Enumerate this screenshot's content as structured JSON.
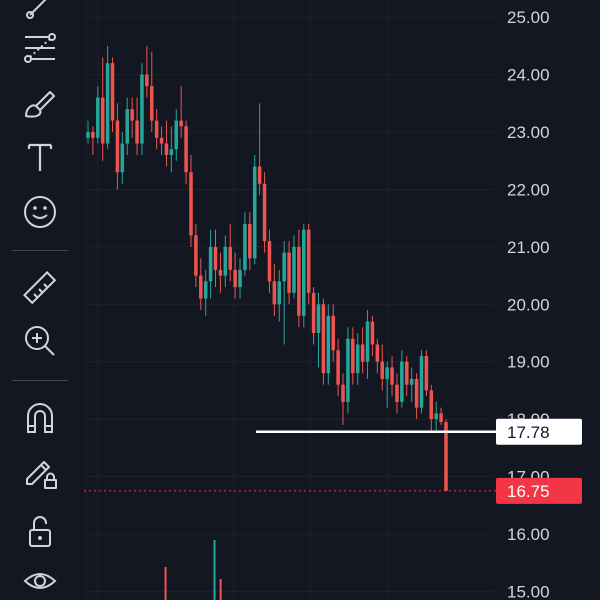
{
  "toolbar": {
    "icons": [
      "trend-line-icon",
      "fib-retracement-icon",
      "brush-icon",
      "text-icon",
      "emoji-icon",
      "ruler-icon",
      "zoom-in-icon",
      "magnet-icon",
      "lock-drawing-icon",
      "unlock-icon",
      "eye-icon"
    ]
  },
  "colors": {
    "background": "#131722",
    "grid": "#1e222d",
    "up": "#26a69a",
    "down": "#ef5350",
    "axis_text": "#d1d4dc",
    "horizontal_line": "#ffffff",
    "last_price_bg": "#f23645"
  },
  "chart_data": {
    "type": "candlestick",
    "ylim": [
      14.85,
      25.3
    ],
    "y_ticks": [
      "25.00",
      "24.00",
      "23.00",
      "22.00",
      "21.00",
      "20.00",
      "19.00",
      "18.00",
      "17.00",
      "16.00",
      "15.00"
    ],
    "horizontal_line": {
      "value": 17.78,
      "label": "17.78"
    },
    "last_price": {
      "value": 16.75,
      "label": "16.75"
    },
    "candles": [
      [
        22.9,
        23.2,
        22.8,
        23.0
      ],
      [
        23.0,
        23.1,
        22.6,
        22.9
      ],
      [
        22.9,
        23.8,
        22.8,
        23.6
      ],
      [
        23.6,
        24.3,
        22.5,
        22.8
      ],
      [
        22.8,
        24.5,
        22.7,
        24.2
      ],
      [
        24.2,
        24.3,
        23.0,
        23.2
      ],
      [
        23.2,
        23.5,
        22.0,
        22.3
      ],
      [
        22.3,
        23.0,
        22.1,
        22.8
      ],
      [
        22.8,
        23.6,
        22.6,
        23.4
      ],
      [
        23.4,
        23.6,
        22.9,
        23.2
      ],
      [
        23.2,
        23.6,
        22.6,
        22.8
      ],
      [
        22.8,
        24.2,
        22.6,
        24.0
      ],
      [
        24.0,
        24.5,
        23.6,
        23.8
      ],
      [
        23.8,
        24.4,
        23.0,
        23.2
      ],
      [
        23.2,
        23.4,
        22.7,
        22.9
      ],
      [
        22.9,
        23.1,
        22.6,
        22.8
      ],
      [
        22.8,
        23.2,
        22.4,
        22.6
      ],
      [
        22.6,
        23.1,
        22.3,
        22.7
      ],
      [
        22.7,
        23.4,
        22.5,
        23.2
      ],
      [
        23.2,
        23.8,
        22.9,
        23.1
      ],
      [
        23.1,
        23.2,
        22.1,
        22.3
      ],
      [
        22.3,
        22.6,
        21.0,
        21.2
      ],
      [
        21.2,
        21.4,
        20.3,
        20.5
      ],
      [
        20.5,
        20.8,
        19.9,
        20.1
      ],
      [
        20.1,
        20.6,
        19.8,
        20.4
      ],
      [
        20.4,
        21.3,
        20.1,
        21.0
      ],
      [
        21.0,
        21.3,
        20.3,
        20.6
      ],
      [
        20.6,
        20.9,
        20.2,
        20.5
      ],
      [
        20.5,
        21.2,
        20.3,
        21.0
      ],
      [
        21.0,
        21.4,
        20.4,
        20.6
      ],
      [
        20.6,
        20.9,
        20.1,
        20.3
      ],
      [
        20.3,
        20.8,
        20.1,
        20.6
      ],
      [
        20.6,
        21.6,
        20.5,
        21.4
      ],
      [
        21.4,
        21.6,
        20.6,
        20.8
      ],
      [
        20.8,
        22.6,
        20.7,
        22.4
      ],
      [
        22.4,
        23.5,
        21.9,
        22.1
      ],
      [
        22.1,
        22.3,
        20.9,
        21.1
      ],
      [
        21.1,
        21.3,
        20.2,
        20.4
      ],
      [
        20.4,
        20.7,
        19.8,
        20.0
      ],
      [
        20.0,
        20.6,
        19.7,
        20.4
      ],
      [
        20.4,
        21.1,
        19.3,
        20.9
      ],
      [
        20.9,
        21.1,
        20.0,
        20.2
      ],
      [
        20.2,
        21.2,
        20.1,
        21.0
      ],
      [
        21.0,
        21.3,
        19.6,
        19.8
      ],
      [
        19.8,
        21.4,
        19.6,
        21.3
      ],
      [
        21.3,
        21.4,
        20.0,
        20.2
      ],
      [
        20.2,
        20.3,
        19.3,
        19.5
      ],
      [
        19.5,
        20.2,
        18.9,
        20.0
      ],
      [
        20.0,
        20.1,
        18.6,
        18.8
      ],
      [
        18.8,
        20.0,
        18.6,
        19.8
      ],
      [
        19.8,
        20.0,
        19.0,
        19.2
      ],
      [
        19.2,
        19.4,
        18.4,
        18.6
      ],
      [
        18.6,
        18.8,
        17.9,
        18.3
      ],
      [
        18.3,
        19.6,
        18.1,
        19.4
      ],
      [
        19.4,
        19.6,
        18.6,
        18.8
      ],
      [
        18.8,
        19.5,
        18.6,
        19.3
      ],
      [
        19.3,
        19.6,
        18.8,
        19.0
      ],
      [
        19.0,
        19.9,
        18.7,
        19.7
      ],
      [
        19.7,
        19.8,
        19.1,
        19.3
      ],
      [
        19.3,
        19.4,
        18.8,
        19.0
      ],
      [
        19.0,
        19.3,
        18.5,
        18.7
      ],
      [
        18.7,
        19.0,
        18.2,
        18.9
      ],
      [
        18.9,
        19.1,
        18.4,
        18.6
      ],
      [
        18.6,
        18.8,
        18.1,
        18.3
      ],
      [
        18.3,
        19.2,
        18.2,
        19.0
      ],
      [
        19.0,
        19.1,
        18.4,
        18.6
      ],
      [
        18.6,
        18.9,
        18.3,
        18.7
      ],
      [
        18.7,
        18.8,
        18.0,
        18.2
      ],
      [
        18.2,
        19.2,
        18.1,
        19.1
      ],
      [
        19.1,
        19.2,
        18.4,
        18.5
      ],
      [
        18.5,
        18.6,
        17.8,
        18.0
      ],
      [
        18.0,
        18.3,
        17.8,
        18.1
      ],
      [
        18.1,
        18.2,
        17.9,
        17.95
      ],
      [
        17.95,
        18.0,
        16.75,
        16.75
      ]
    ],
    "volume_x_ratio": [
      0.195,
      0.315,
      0.33
    ],
    "volume_bars": [
      {
        "value": 0.55,
        "dir": "down"
      },
      {
        "value": 1.0,
        "dir": "up"
      },
      {
        "value": 0.35,
        "dir": "down"
      }
    ]
  }
}
